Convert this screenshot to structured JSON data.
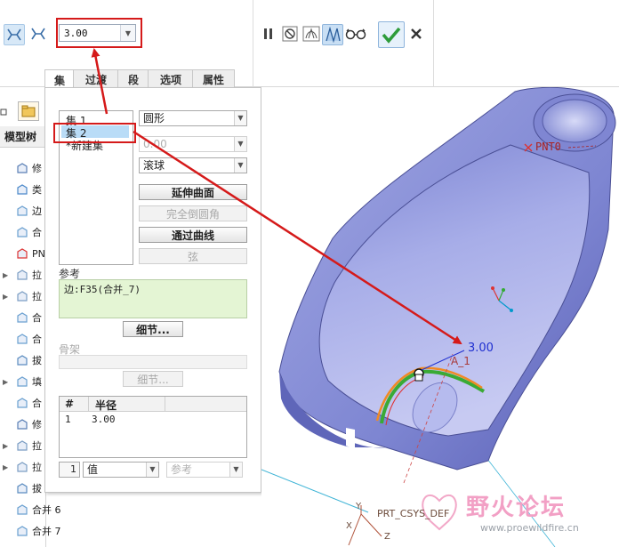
{
  "toolbar": {
    "radius_value": "3.00",
    "icons": [
      "cross-section-icon",
      "cross-section-alt-icon",
      "pause-icon",
      "stop-preview-icon",
      "preview-geometry-icon",
      "mesh-icon",
      "glasses-icon",
      "confirm-check-icon",
      "cancel-x-icon"
    ]
  },
  "tabs": [
    {
      "label": "集",
      "active": true
    },
    {
      "label": "过渡",
      "active": false
    },
    {
      "label": "段",
      "active": false
    },
    {
      "label": "选项",
      "active": false
    },
    {
      "label": "属性",
      "active": false
    }
  ],
  "sets_list": {
    "items": [
      {
        "label": "集 1",
        "selected": false
      },
      {
        "label": "集 2",
        "selected": true
      },
      {
        "label": "*新建集",
        "selected": false
      }
    ]
  },
  "shape_select": "圆形",
  "value_select": "0.00",
  "method_select": "滚球",
  "buttons": {
    "extend_surface": "延伸曲面",
    "full_round": "完全倒圆角",
    "through_curve": "通过曲线",
    "chord": "弦"
  },
  "references": {
    "label": "参考",
    "value": "边:F35(合并_7)",
    "details_button": "细节..."
  },
  "skeleton": {
    "label": "骨架",
    "details_button": "细节..."
  },
  "radius_table": {
    "headers": [
      "#",
      "半径"
    ],
    "rows": [
      [
        "1",
        "3.00"
      ]
    ]
  },
  "bottom_row": {
    "index": "1",
    "value_select": "值",
    "ref_select": "参考"
  },
  "model_tree": {
    "label": "模型树",
    "items": [
      {
        "label": "修",
        "expand": false
      },
      {
        "label": "类",
        "expand": false
      },
      {
        "label": "边",
        "expand": false
      },
      {
        "label": "合",
        "expand": false
      },
      {
        "label": "PN",
        "expand": false
      },
      {
        "label": "拉",
        "expand": true
      },
      {
        "label": "拉",
        "expand": true
      },
      {
        "label": "合",
        "expand": false
      },
      {
        "label": "合",
        "expand": false
      },
      {
        "label": "拔",
        "expand": false
      },
      {
        "label": "填",
        "expand": true
      },
      {
        "label": "合",
        "expand": false
      },
      {
        "label": "修",
        "expand": false
      },
      {
        "label": "拉",
        "expand": true
      },
      {
        "label": "拉",
        "expand": true
      },
      {
        "label": "拔",
        "expand": false
      },
      {
        "label": "合并 6",
        "expand": false
      },
      {
        "label": "合并 7",
        "expand": false
      }
    ]
  },
  "viewport": {
    "point_label": "PNT0",
    "dimension_label": "3.00",
    "axis_label": "A_1",
    "csys_label": "PRT_CSYS_DEF",
    "csys_axes": [
      "Y",
      "X",
      "Z"
    ]
  },
  "watermark": {
    "title": "野火论坛",
    "url": "www.proewildfire.cn"
  },
  "colors": {
    "model_face": "#8c93d8",
    "annotation_red": "#d51a1a",
    "dimension_blue": "#1f2fd0",
    "selection_blue": "#b9dcf7",
    "confirm_green": "#2e9c3a"
  }
}
